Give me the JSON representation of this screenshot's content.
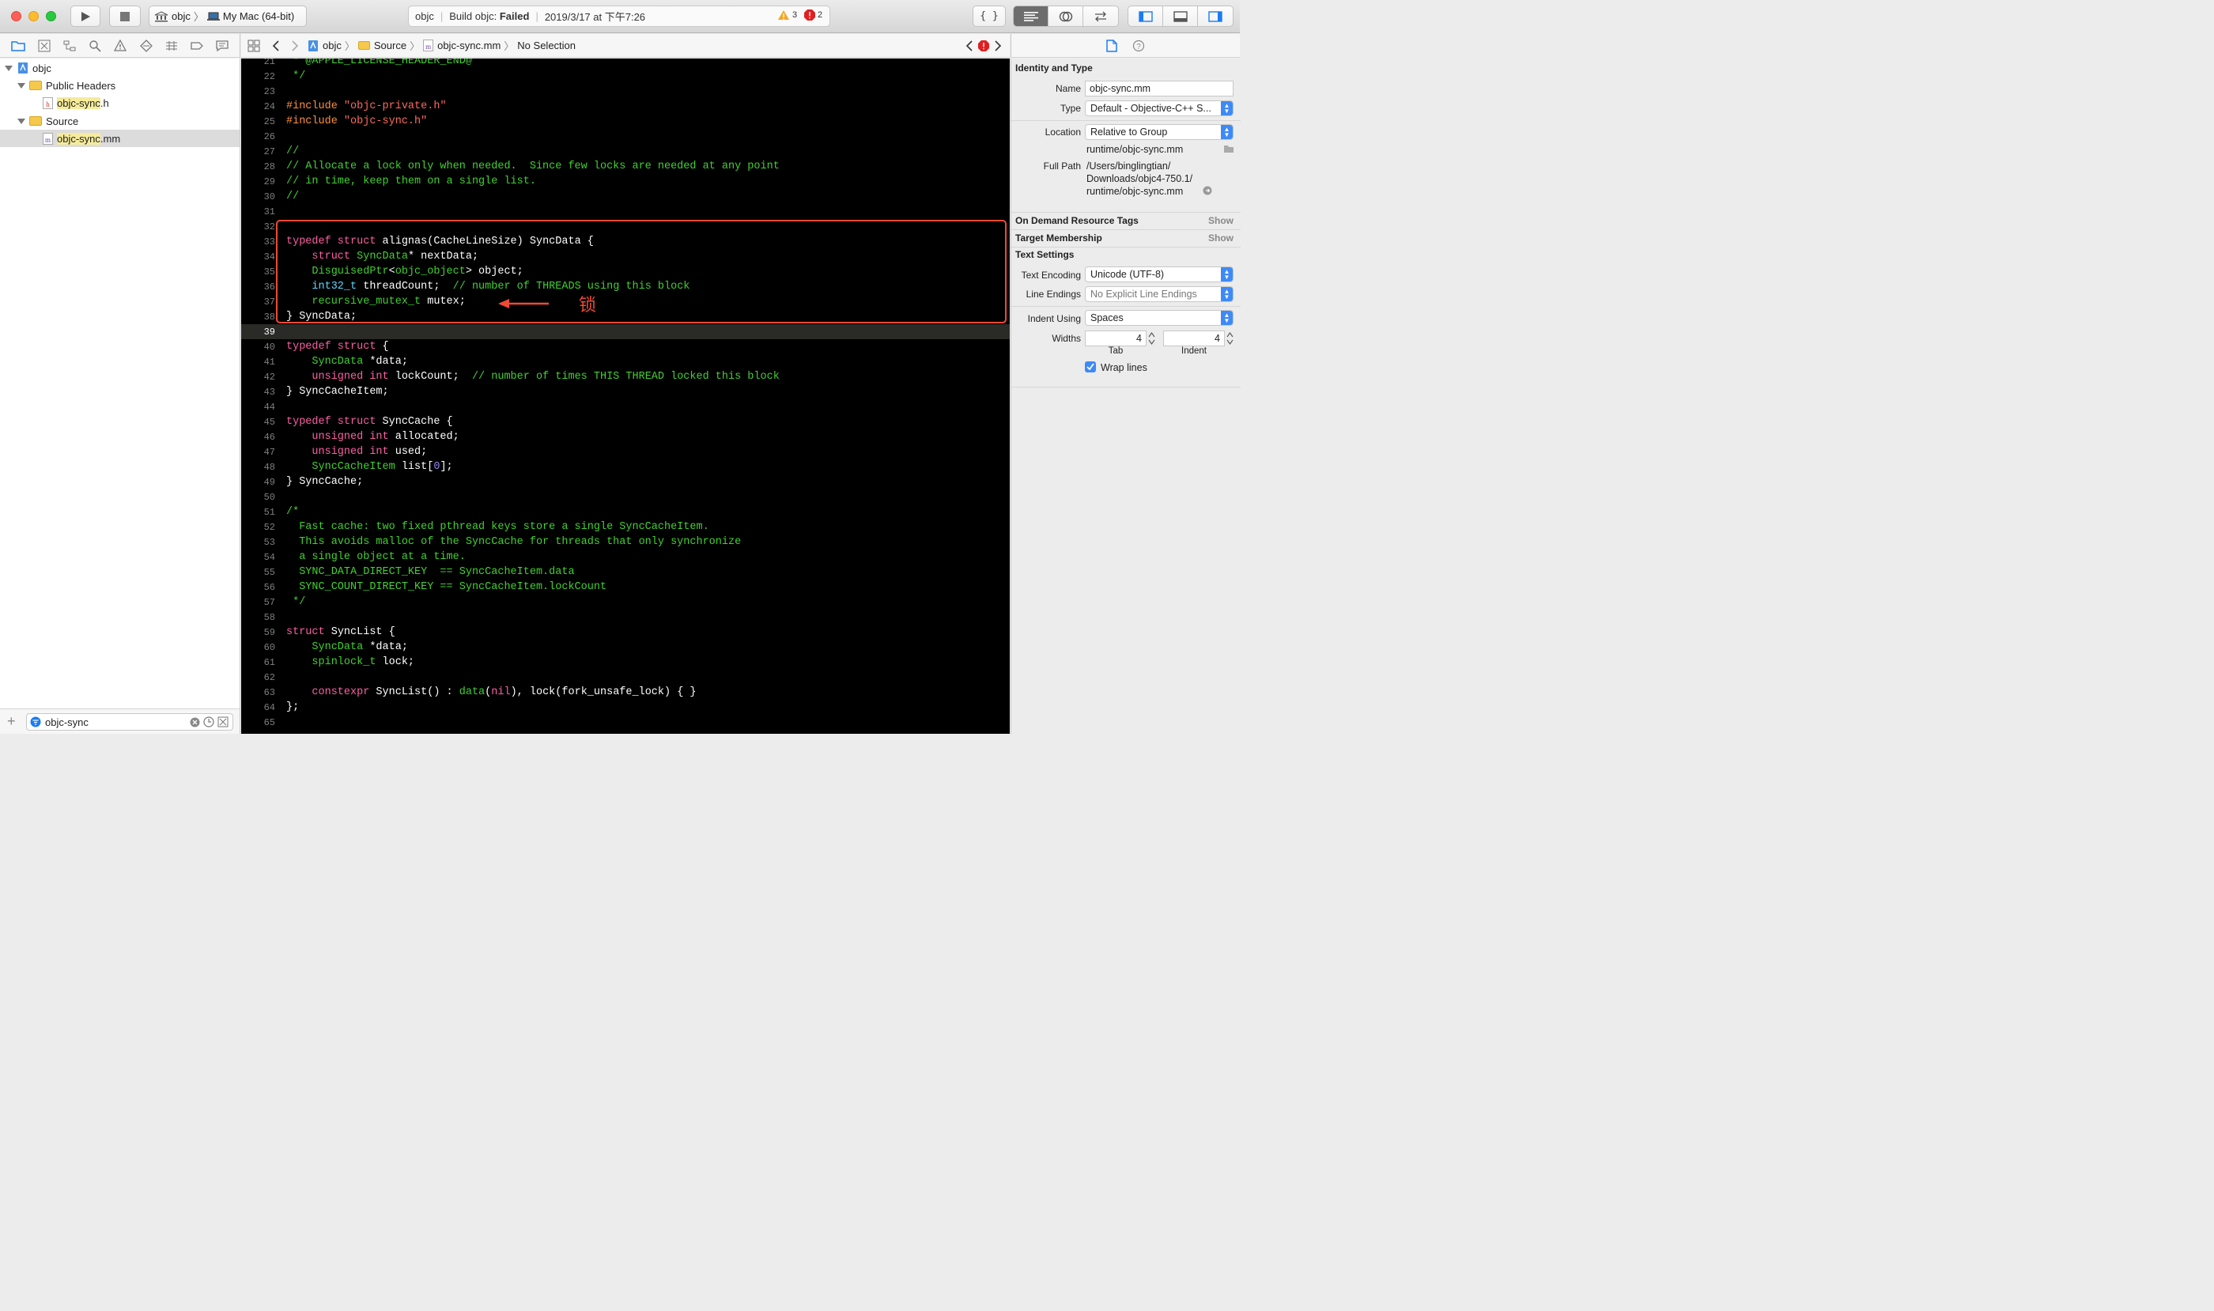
{
  "toolbar": {
    "scheme": "objc",
    "destination": "My Mac (64-bit)",
    "activity_project": "objc",
    "activity_status_prefix": "Build objc:",
    "activity_status": "Failed",
    "activity_time": "2019/3/17 at 下午7:26",
    "warnings": "3",
    "errors": "2",
    "braces": "{ }"
  },
  "colors": {
    "error": "#e02020",
    "warning": "#f5a623",
    "highlight_box": "#f04a34",
    "accent": "#3d8af7"
  },
  "navigator": {
    "items": [
      {
        "label": "objc",
        "level": 0,
        "kind": "project"
      },
      {
        "label": "Public Headers",
        "level": 1,
        "kind": "folder"
      },
      {
        "label_hl": "objc-sync",
        "label_rest": ".h",
        "level": 2,
        "kind": "file",
        "badge": "h"
      },
      {
        "label": "Source",
        "level": 1,
        "kind": "folder"
      },
      {
        "label_hl": "objc-sync",
        "label_rest": ".mm",
        "level": 2,
        "kind": "file",
        "badge": "m",
        "selected": true
      }
    ],
    "filter_value": "objc-sync"
  },
  "jumpbar": {
    "crumbs": [
      "objc",
      "Source",
      "objc-sync.mm",
      "No Selection"
    ]
  },
  "editor": {
    "lines": [
      {
        "n": "21",
        "t": [
          [
            "cmt",
            " * @APPLE_LICENSE_HEADER_END@"
          ]
        ]
      },
      {
        "n": "22",
        "t": [
          [
            "cmt",
            " */"
          ]
        ]
      },
      {
        "n": "23",
        "t": []
      },
      {
        "n": "24",
        "t": [
          [
            "pre",
            "#include "
          ],
          [
            "str",
            "\"objc-private.h\""
          ]
        ]
      },
      {
        "n": "25",
        "t": [
          [
            "pre",
            "#include "
          ],
          [
            "str",
            "\"objc-sync.h\""
          ]
        ]
      },
      {
        "n": "26",
        "t": []
      },
      {
        "n": "27",
        "t": [
          [
            "cmt",
            "//"
          ]
        ]
      },
      {
        "n": "28",
        "t": [
          [
            "cmt",
            "// Allocate a lock only when needed.  Since few locks are needed at any point"
          ]
        ]
      },
      {
        "n": "29",
        "t": [
          [
            "cmt",
            "// in time, keep them on a single list."
          ]
        ]
      },
      {
        "n": "30",
        "t": [
          [
            "cmt",
            "//"
          ]
        ]
      },
      {
        "n": "31",
        "t": []
      },
      {
        "n": "32",
        "t": []
      },
      {
        "n": "33",
        "t": [
          [
            "kw",
            "typedef struct "
          ],
          [
            "",
            "alignas(CacheLineSize) SyncData {"
          ]
        ]
      },
      {
        "n": "34",
        "t": [
          [
            "",
            "    "
          ],
          [
            "kw",
            "struct "
          ],
          [
            "usr",
            "SyncData"
          ],
          [
            "",
            "* nextData;"
          ]
        ]
      },
      {
        "n": "35",
        "t": [
          [
            "",
            "    "
          ],
          [
            "usr",
            "DisguisedPtr"
          ],
          [
            "",
            "<"
          ],
          [
            "usr",
            "objc_object"
          ],
          [
            "",
            "> object;"
          ]
        ]
      },
      {
        "n": "36",
        "t": [
          [
            "",
            "    "
          ],
          [
            "typ",
            "int32_t"
          ],
          [
            "",
            " threadCount;  "
          ],
          [
            "cmt",
            "// number of THREADS using this block"
          ]
        ]
      },
      {
        "n": "37",
        "t": [
          [
            "",
            "    "
          ],
          [
            "usr",
            "recursive_mutex_t"
          ],
          [
            "",
            " mutex;"
          ]
        ]
      },
      {
        "n": "38",
        "t": [
          [
            "",
            "} SyncData;"
          ]
        ]
      },
      {
        "n": "39",
        "t": [],
        "cur": true
      },
      {
        "n": "40",
        "t": [
          [
            "kw",
            "typedef struct "
          ],
          [
            "",
            "{"
          ]
        ]
      },
      {
        "n": "41",
        "t": [
          [
            "",
            "    "
          ],
          [
            "usr",
            "SyncData"
          ],
          [
            "",
            " *data;"
          ]
        ]
      },
      {
        "n": "42",
        "t": [
          [
            "",
            "    "
          ],
          [
            "kw",
            "unsigned int"
          ],
          [
            "",
            " lockCount;  "
          ],
          [
            "cmt",
            "// number of times THIS THREAD locked this block"
          ]
        ]
      },
      {
        "n": "43",
        "t": [
          [
            "",
            "} SyncCacheItem;"
          ]
        ]
      },
      {
        "n": "44",
        "t": []
      },
      {
        "n": "45",
        "t": [
          [
            "kw",
            "typedef struct "
          ],
          [
            "",
            "SyncCache {"
          ]
        ]
      },
      {
        "n": "46",
        "t": [
          [
            "",
            "    "
          ],
          [
            "kw",
            "unsigned int"
          ],
          [
            "",
            " allocated;"
          ]
        ]
      },
      {
        "n": "47",
        "t": [
          [
            "",
            "    "
          ],
          [
            "kw",
            "unsigned int"
          ],
          [
            "",
            " used;"
          ]
        ]
      },
      {
        "n": "48",
        "t": [
          [
            "",
            "    "
          ],
          [
            "usr",
            "SyncCacheItem"
          ],
          [
            "",
            " list["
          ],
          [
            "num",
            "0"
          ],
          [
            "",
            "];"
          ]
        ]
      },
      {
        "n": "49",
        "t": [
          [
            "",
            "} SyncCache;"
          ]
        ]
      },
      {
        "n": "50",
        "t": []
      },
      {
        "n": "51",
        "t": [
          [
            "cmt",
            "/*"
          ]
        ]
      },
      {
        "n": "52",
        "t": [
          [
            "cmt",
            "  Fast cache: two fixed pthread keys store a single SyncCacheItem."
          ]
        ]
      },
      {
        "n": "53",
        "t": [
          [
            "cmt",
            "  This avoids malloc of the SyncCache for threads that only synchronize"
          ]
        ]
      },
      {
        "n": "54",
        "t": [
          [
            "cmt",
            "  a single object at a time."
          ]
        ]
      },
      {
        "n": "55",
        "t": [
          [
            "cmt",
            "  SYNC_DATA_DIRECT_KEY  == SyncCacheItem.data"
          ]
        ]
      },
      {
        "n": "56",
        "t": [
          [
            "cmt",
            "  SYNC_COUNT_DIRECT_KEY == SyncCacheItem.lockCount"
          ]
        ]
      },
      {
        "n": "57",
        "t": [
          [
            "cmt",
            " */"
          ]
        ]
      },
      {
        "n": "58",
        "t": []
      },
      {
        "n": "59",
        "t": [
          [
            "kw",
            "struct "
          ],
          [
            "",
            "SyncList {"
          ]
        ]
      },
      {
        "n": "60",
        "t": [
          [
            "",
            "    "
          ],
          [
            "usr",
            "SyncData"
          ],
          [
            "",
            " *data;"
          ]
        ]
      },
      {
        "n": "61",
        "t": [
          [
            "",
            "    "
          ],
          [
            "usr",
            "spinlock_t"
          ],
          [
            "",
            " lock;"
          ]
        ]
      },
      {
        "n": "62",
        "t": []
      },
      {
        "n": "63",
        "t": [
          [
            "",
            "    "
          ],
          [
            "kw",
            "constexpr "
          ],
          [
            "",
            "SyncList() : "
          ],
          [
            "usr",
            "data"
          ],
          [
            "",
            "("
          ],
          [
            "nil",
            "nil"
          ],
          [
            "",
            "), lock(fork_unsafe_lock) { }"
          ]
        ]
      },
      {
        "n": "64",
        "t": [
          [
            "",
            "};"
          ]
        ]
      },
      {
        "n": "65",
        "t": []
      }
    ],
    "annotation": "锁"
  },
  "inspector": {
    "identity_title": "Identity and Type",
    "name_label": "Name",
    "name_value": "objc-sync.mm",
    "type_label": "Type",
    "type_value": "Default - Objective-C++ S...",
    "location_label": "Location",
    "location_value": "Relative to Group",
    "location_path": "runtime/objc-sync.mm",
    "fullpath_label": "Full Path",
    "fullpath_1": "/Users/binglingtian/",
    "fullpath_2": "Downloads/objc4-750.1/",
    "fullpath_3": "runtime/objc-sync.mm",
    "odr_title": "On Demand Resource Tags",
    "odr_show": "Show",
    "target_title": "Target Membership",
    "target_show": "Show",
    "text_title": "Text Settings",
    "enc_label": "Text Encoding",
    "enc_value": "Unicode (UTF-8)",
    "le_label": "Line Endings",
    "le_value": "No Explicit Line Endings",
    "indent_label": "Indent Using",
    "indent_value": "Spaces",
    "widths_label": "Widths",
    "tab_value": "4",
    "indent_width_value": "4",
    "tab_caption": "Tab",
    "indent_caption": "Indent",
    "wrap_label": "Wrap lines",
    "wrap_checked": true
  }
}
